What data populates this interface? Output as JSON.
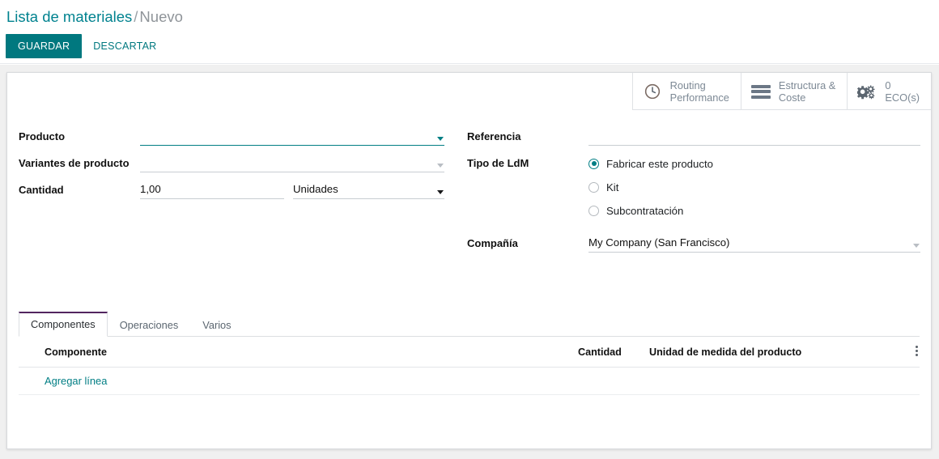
{
  "breadcrumb": {
    "root": "Lista de materiales",
    "separator": "/",
    "current": "Nuevo"
  },
  "actions": {
    "save_label": "GUARDAR",
    "discard_label": "DESCARTAR"
  },
  "stat_buttons": [
    {
      "icon": "clock-icon",
      "line1": "Routing",
      "line2": "Performance"
    },
    {
      "icon": "list-icon",
      "line1": "Estructura &",
      "line2": "Coste"
    },
    {
      "icon": "cogs-icon",
      "line1": "0",
      "line2": "ECO(s)"
    }
  ],
  "form": {
    "left": {
      "producto_label": "Producto",
      "producto_value": "",
      "variantes_label": "Variantes de producto",
      "variantes_value": "",
      "cantidad_label": "Cantidad",
      "cantidad_value": "1,00",
      "uom_value": "Unidades"
    },
    "right": {
      "referencia_label": "Referencia",
      "referencia_value": "",
      "tipo_label": "Tipo de LdM",
      "tipo_options": [
        {
          "label": "Fabricar este producto",
          "selected": true
        },
        {
          "label": "Kit",
          "selected": false
        },
        {
          "label": "Subcontratación",
          "selected": false
        }
      ],
      "compania_label": "Compañía",
      "compania_value": "My Company (San Francisco)"
    }
  },
  "notebook": {
    "tabs": [
      {
        "label": "Componentes",
        "active": true
      },
      {
        "label": "Operaciones",
        "active": false
      },
      {
        "label": "Varios",
        "active": false
      }
    ],
    "table": {
      "headers": {
        "componente": "Componente",
        "cantidad": "Cantidad",
        "uom": "Unidad de medida del producto",
        "options_icon": "vertical-dots-icon"
      },
      "add_line_label": "Agregar línea",
      "rows": []
    }
  },
  "colors": {
    "accent": "#00787f",
    "breadcrumb_root": "#00828f",
    "tab_active_border": "#52255f",
    "stat_text": "#7d8995",
    "page_background": "#f0f0f0"
  }
}
